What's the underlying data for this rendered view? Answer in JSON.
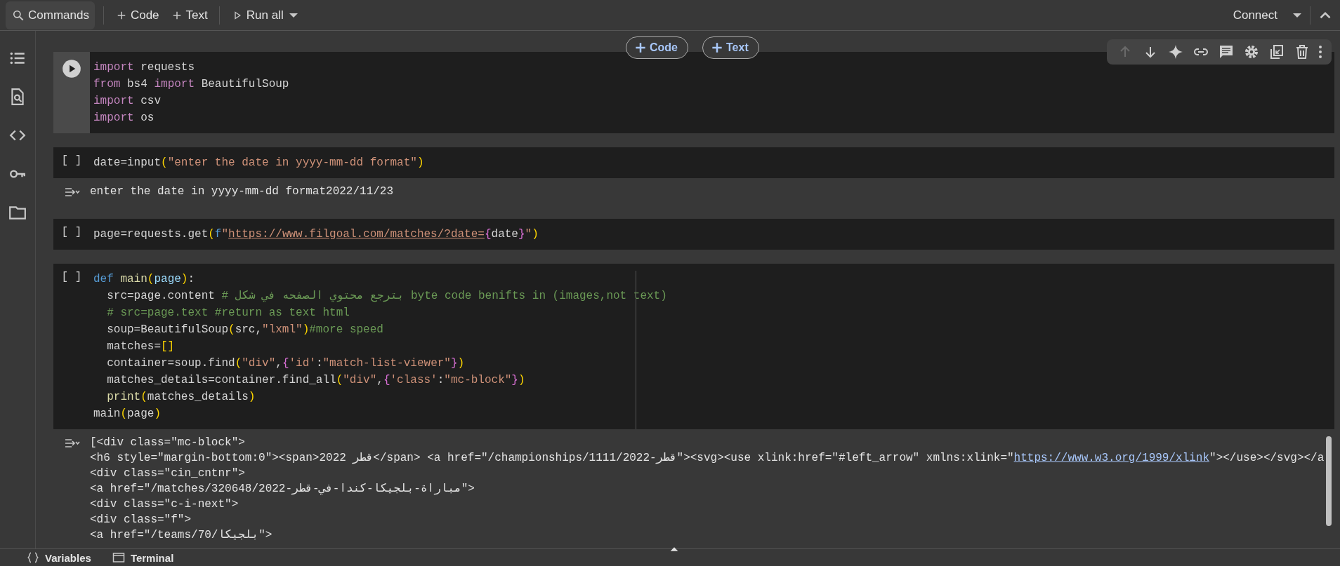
{
  "toolbar": {
    "items": [
      {
        "kind": "search",
        "label": "Commands"
      },
      {
        "kind": "add",
        "label": "Code"
      },
      {
        "kind": "add",
        "label": "Text"
      },
      {
        "kind": "run",
        "label": "Run all"
      }
    ],
    "connect": "Connect"
  },
  "insert_buttons": [
    {
      "label": "Code"
    },
    {
      "label": "Text"
    }
  ],
  "cell_toolbar": {
    "move_up_disabled": true
  },
  "cells": [
    {
      "selected": true,
      "lines": [
        {
          "tokens": [
            {
              "kind": "kw",
              "text": "import"
            },
            {
              "kind": "p",
              "text": " requests"
            }
          ]
        },
        {
          "tokens": [
            {
              "kind": "kw",
              "text": "from"
            },
            {
              "kind": "p",
              "text": " bs4 "
            },
            {
              "kind": "kw",
              "text": "import"
            },
            {
              "kind": "p",
              "text": " BeautifulSoup"
            }
          ]
        },
        {
          "tokens": [
            {
              "kind": "kw",
              "text": "import"
            },
            {
              "kind": "p",
              "text": " csv"
            }
          ]
        },
        {
          "tokens": [
            {
              "kind": "kw",
              "text": "import"
            },
            {
              "kind": "p",
              "text": " os"
            }
          ]
        }
      ]
    },
    {
      "selected": false,
      "exec_label": "[ ]",
      "lines": [
        {
          "tokens": [
            {
              "kind": "p",
              "text": "date=input"
            },
            {
              "kind": "par",
              "text": "("
            },
            {
              "kind": "str",
              "text": "\"enter the date in yyyy-mm-dd format\""
            },
            {
              "kind": "par",
              "text": ")"
            }
          ]
        }
      ],
      "output": {
        "lines": [
          {
            "tokens": [
              {
                "kind": "p",
                "text": "enter the date in yyyy-mm-dd format2022/11/23"
              }
            ]
          }
        ]
      }
    },
    {
      "selected": false,
      "exec_label": "[ ]",
      "lines": [
        {
          "tokens": [
            {
              "kind": "p",
              "text": "page=requests.get"
            },
            {
              "kind": "par",
              "text": "("
            },
            {
              "kind": "def",
              "text": "f"
            },
            {
              "kind": "str",
              "text": "\""
            },
            {
              "kind": "link",
              "text": "https://www.filgoal.com/matches/?date="
            },
            {
              "kind": "br",
              "text": "{"
            },
            {
              "kind": "p",
              "text": "date"
            },
            {
              "kind": "br",
              "text": "}"
            },
            {
              "kind": "str",
              "text": "\""
            },
            {
              "kind": "par",
              "text": ")"
            }
          ]
        }
      ]
    },
    {
      "selected": false,
      "exec_label": "[ ]",
      "lines": [
        {
          "tokens": [
            {
              "kind": "def",
              "text": "def "
            },
            {
              "kind": "fn",
              "text": "main"
            },
            {
              "kind": "par",
              "text": "("
            },
            {
              "kind": "param",
              "text": "page"
            },
            {
              "kind": "par",
              "text": ")"
            },
            {
              "kind": "p",
              "text": ":"
            }
          ]
        },
        {
          "tokens": [
            {
              "kind": "p",
              "text": "  src=page.content "
            },
            {
              "kind": "cm",
              "text": "# بترجع محتوي الصفحه في شكل byte code benifts in (images,not text)"
            }
          ]
        },
        {
          "tokens": [
            {
              "kind": "cm",
              "text": "  # src=page.text #return as text html"
            }
          ]
        },
        {
          "tokens": [
            {
              "kind": "p",
              "text": "  soup=BeautifulSoup"
            },
            {
              "kind": "par",
              "text": "("
            },
            {
              "kind": "p",
              "text": "src,"
            },
            {
              "kind": "str",
              "text": "\"lxml\""
            },
            {
              "kind": "par",
              "text": ")"
            },
            {
              "kind": "cm",
              "text": "#more speed"
            }
          ]
        },
        {
          "tokens": [
            {
              "kind": "p",
              "text": "  matches="
            },
            {
              "kind": "par",
              "text": "[]"
            }
          ]
        },
        {
          "tokens": [
            {
              "kind": "p",
              "text": "  container=soup.find"
            },
            {
              "kind": "par",
              "text": "("
            },
            {
              "kind": "str",
              "text": "\"div\""
            },
            {
              "kind": "p",
              "text": ","
            },
            {
              "kind": "br",
              "text": "{"
            },
            {
              "kind": "str",
              "text": "'id'"
            },
            {
              "kind": "p",
              "text": ":"
            },
            {
              "kind": "str",
              "text": "\"match-list-viewer\""
            },
            {
              "kind": "br",
              "text": "}"
            },
            {
              "kind": "par",
              "text": ")"
            }
          ]
        },
        {
          "tokens": [
            {
              "kind": "p",
              "text": "  matches_details=container.find_all"
            },
            {
              "kind": "par",
              "text": "("
            },
            {
              "kind": "str",
              "text": "\"div\""
            },
            {
              "kind": "p",
              "text": ","
            },
            {
              "kind": "br",
              "text": "{"
            },
            {
              "kind": "str",
              "text": "'class'"
            },
            {
              "kind": "p",
              "text": ":"
            },
            {
              "kind": "str",
              "text": "\"mc-block\""
            },
            {
              "kind": "br",
              "text": "}"
            },
            {
              "kind": "par",
              "text": ")"
            }
          ]
        },
        {
          "tokens": [
            {
              "kind": "fn",
              "text": "  print"
            },
            {
              "kind": "par",
              "text": "("
            },
            {
              "kind": "p",
              "text": "matches_details"
            },
            {
              "kind": "par",
              "text": ")"
            }
          ]
        },
        {
          "tokens": [
            {
              "kind": "p",
              "text": "main"
            },
            {
              "kind": "par",
              "text": "("
            },
            {
              "kind": "p",
              "text": "page"
            },
            {
              "kind": "par",
              "text": ")"
            }
          ]
        }
      ],
      "output": {
        "lines": [
          {
            "tokens": [
              {
                "kind": "p",
                "text": "[<div class=\"mc-block\">"
              }
            ]
          },
          {
            "tokens": [
              {
                "kind": "p",
                "text": "<h6 style=\"margin-bottom:0\"><span>قطر 2022</span> <a href=\"/championships/1111/قطر-2022\"><svg><use xlink:href=\"#left_arrow\" xmlns:xlink=\""
              },
              {
                "kind": "link",
                "text": "https://www.w3.org/1999/xlink"
              },
              {
                "kind": "p",
                "text": "\"></use></svg></a"
              }
            ]
          },
          {
            "tokens": [
              {
                "kind": "p",
                "text": "<div class=\"cin_cntnr\">"
              }
            ]
          },
          {
            "tokens": [
              {
                "kind": "p",
                "text": "<a href=\"/matches/320648/مباراة-بلجيكا-كندا-في-قطر-2022\">"
              }
            ]
          },
          {
            "tokens": [
              {
                "kind": "p",
                "text": "<div class=\"c-i-next\">"
              }
            ]
          },
          {
            "tokens": [
              {
                "kind": "p",
                "text": "<div class=\"f\">"
              }
            ]
          },
          {
            "tokens": [
              {
                "kind": "p",
                "text": "<a href=\"/teams/70/بلجيكا\">"
              }
            ]
          }
        ]
      }
    }
  ],
  "bottom_bar": [
    {
      "kind": "variables",
      "label": "Variables"
    },
    {
      "kind": "terminal",
      "label": "Terminal"
    }
  ]
}
